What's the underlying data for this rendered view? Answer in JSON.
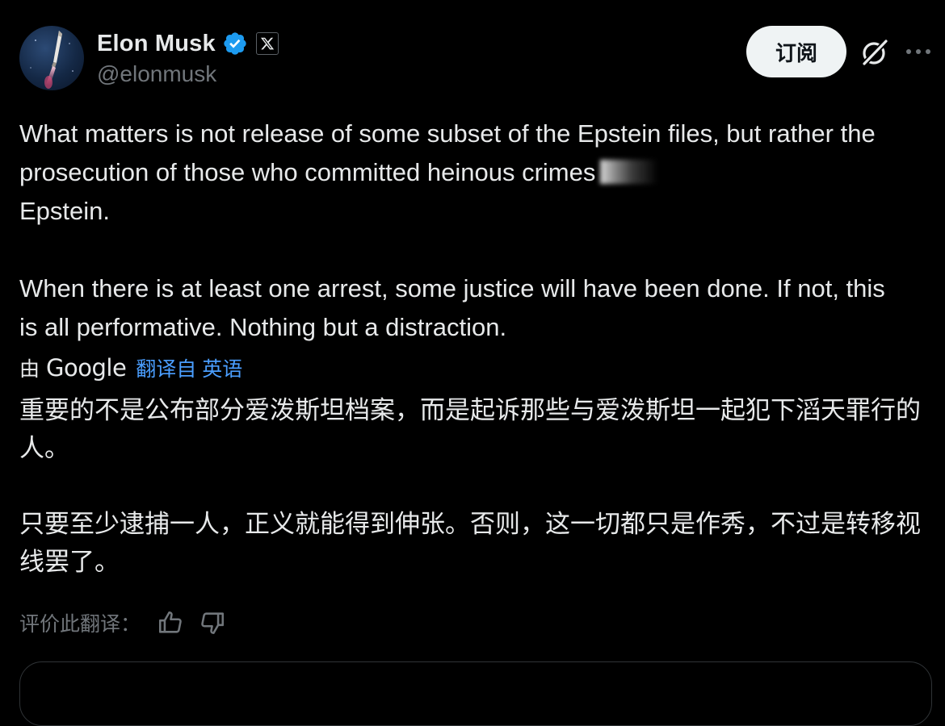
{
  "author": {
    "display_name": "Elon Musk",
    "handle": "@elonmusk",
    "verified_icon": "verified-badge-icon",
    "affiliation_icon": "x-logo-icon",
    "avatar_icon": "rocket-avatar"
  },
  "actions": {
    "subscribe_label": "订阅",
    "grok_icon": "grok-icon",
    "more_icon": "more-dots-icon"
  },
  "tweet": {
    "paragraph_1_before_redaction": "What matters is not release of some subset of the Epstein files, but rather the prosecution of those who committed heinous crimes",
    "paragraph_1_after_redaction": "Epstein.",
    "paragraph_2": "When there is at least one arrest, some justice will have been done. If not, this is all performative. Nothing but a distraction."
  },
  "translation": {
    "by_label": "由",
    "provider": "Google",
    "translated_from": "翻译自 英语",
    "paragraph_1": "重要的不是公布部分爱泼斯坦档案，而是起诉那些与爱泼斯坦一起犯下滔天罪行的人。",
    "paragraph_2": "只要至少逮捕一人，正义就能得到伸张。否则，这一切都只是作秀，不过是转移视线罢了。",
    "rate_label": "评价此翻译：",
    "thumbs_up_icon": "thumbs-up-icon",
    "thumbs_down_icon": "thumbs-down-icon"
  },
  "colors": {
    "background": "#000000",
    "text_primary": "#e7e9ea",
    "text_secondary": "#71767b",
    "verified_blue": "#1d9bf0",
    "link_blue": "#4a9eff",
    "button_bg": "#eff3f4"
  }
}
